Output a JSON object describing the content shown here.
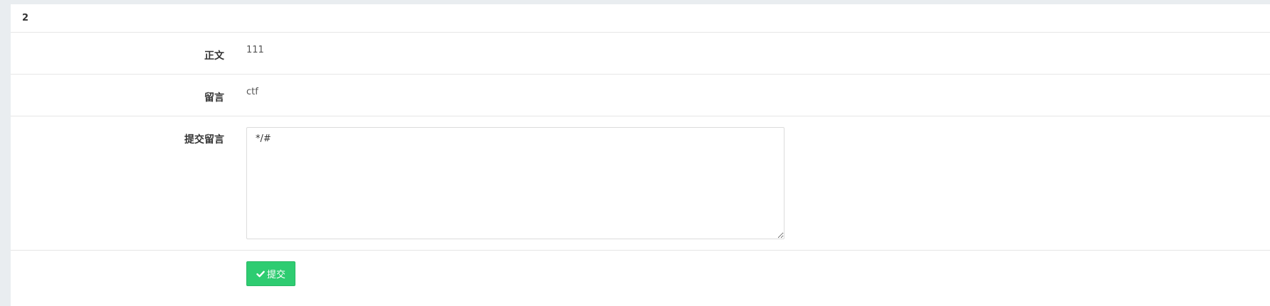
{
  "panel": {
    "title": "2"
  },
  "fields": {
    "body_label": "正文",
    "body_value": "111",
    "comment_label": "留言",
    "comment_value": "ctf",
    "submit_comment_label": "提交留言",
    "submit_comment_value": "*/#"
  },
  "actions": {
    "submit_label": "提交",
    "submit_icon": "check-icon"
  },
  "colors": {
    "accent": "#2ecc71",
    "background": "#e9edf0"
  }
}
